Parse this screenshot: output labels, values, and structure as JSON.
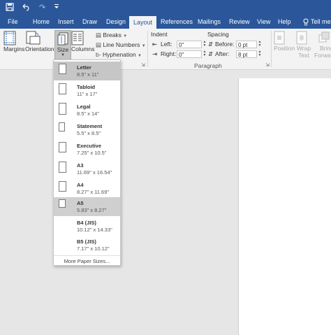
{
  "qat": {
    "redo_symbol": "↷"
  },
  "tabs": [
    "File",
    "Home",
    "Insert",
    "Draw",
    "Design",
    "Layout",
    "References",
    "Mailings",
    "Review",
    "View",
    "Help"
  ],
  "tell_me": "Tell me",
  "ribbon": {
    "margins": "Margins",
    "orientation": "Orientation",
    "size": "Size",
    "columns": "Columns",
    "breaks": "Breaks",
    "line_numbers": "Line Numbers",
    "hyphenation": "Hyphenation",
    "indent_heading": "Indent",
    "indent_left_label": "Left:",
    "indent_left_value": "0\"",
    "indent_right_label": "Right:",
    "indent_right_value": "0\"",
    "spacing_heading": "Spacing",
    "before_label": "Before:",
    "before_value": "0 pt",
    "after_label": "After:",
    "after_value": "8 pt",
    "paragraph_group": "Paragraph",
    "position": "Position",
    "wrap_text_1": "Wrap",
    "wrap_text_2": "Text",
    "bring_forward_1": "Bring",
    "bring_forward_2": "Forward"
  },
  "size_menu": {
    "items": [
      {
        "name": "Letter",
        "dims": "8.5\" x 11\""
      },
      {
        "name": "Tabloid",
        "dims": "11\" x 17\""
      },
      {
        "name": "Legal",
        "dims": "8.5\" x 14\""
      },
      {
        "name": "Statement",
        "dims": "5.5\" x 8.5\""
      },
      {
        "name": "Executive",
        "dims": "7.25\" x 10.5\""
      },
      {
        "name": "A3",
        "dims": "11.69\" x 16.54\""
      },
      {
        "name": "A4",
        "dims": "8.27\" x 11.69\""
      },
      {
        "name": "A5",
        "dims": "5.83\" x 8.27\""
      },
      {
        "name": "B4 (JIS)",
        "dims": "10.12\" x 14.33\""
      },
      {
        "name": "B5 (JIS)",
        "dims": "7.17\" x 10.12\""
      }
    ],
    "more": "More Paper Sizes..."
  },
  "colors": {
    "accent": "#2b579a",
    "ribbon_bg": "#f3f3f3",
    "selected": "#c6c6c6"
  }
}
